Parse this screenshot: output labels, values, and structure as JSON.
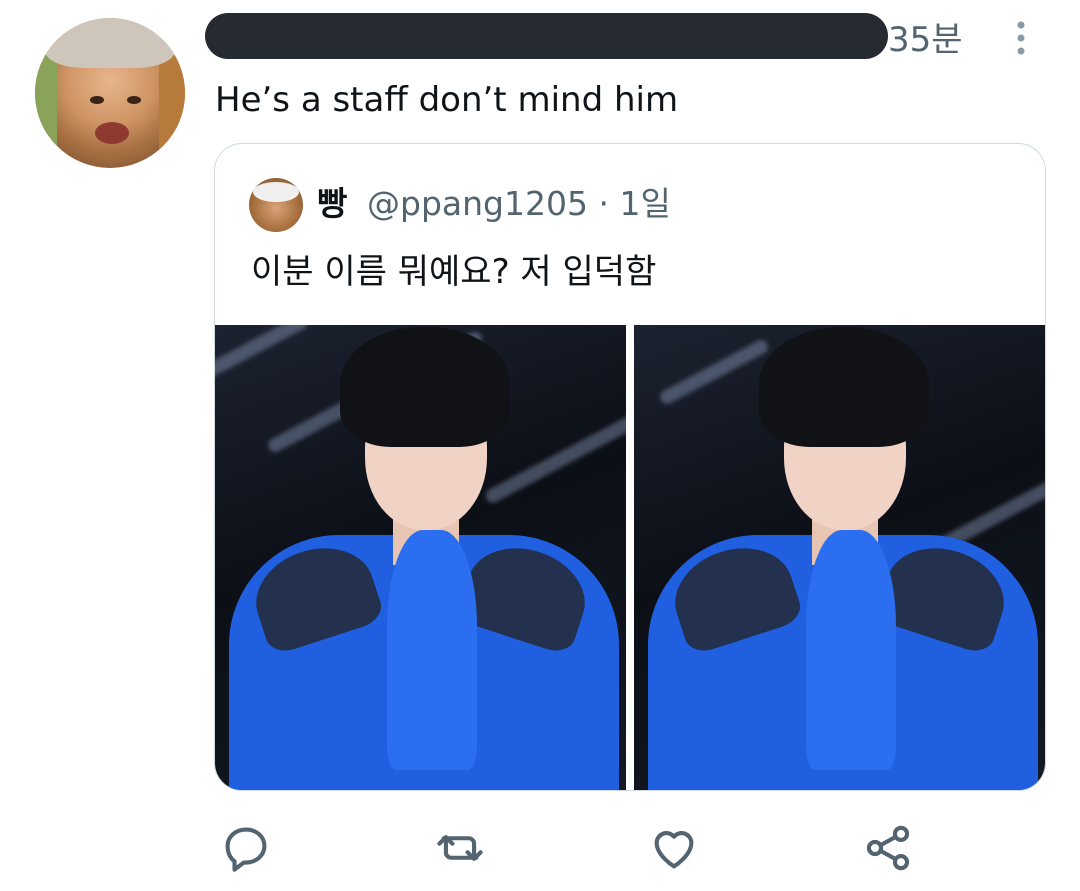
{
  "tweet": {
    "time": "35분",
    "text": "He’s a staff don’t mind him",
    "more_icon": "more-vertical-icon"
  },
  "quote": {
    "name": "빵",
    "handle": "@ppang1205",
    "separator": " · ",
    "time": "1일",
    "text": "이분 이름 뭐예요? 저 입덕함",
    "media_count": 2
  },
  "actions": {
    "icons": [
      "reply-icon",
      "retweet-icon",
      "like-icon",
      "share-icon"
    ]
  },
  "colors": {
    "text_primary": "#0f1419",
    "text_secondary": "#536471",
    "border": "#cfd9de"
  }
}
